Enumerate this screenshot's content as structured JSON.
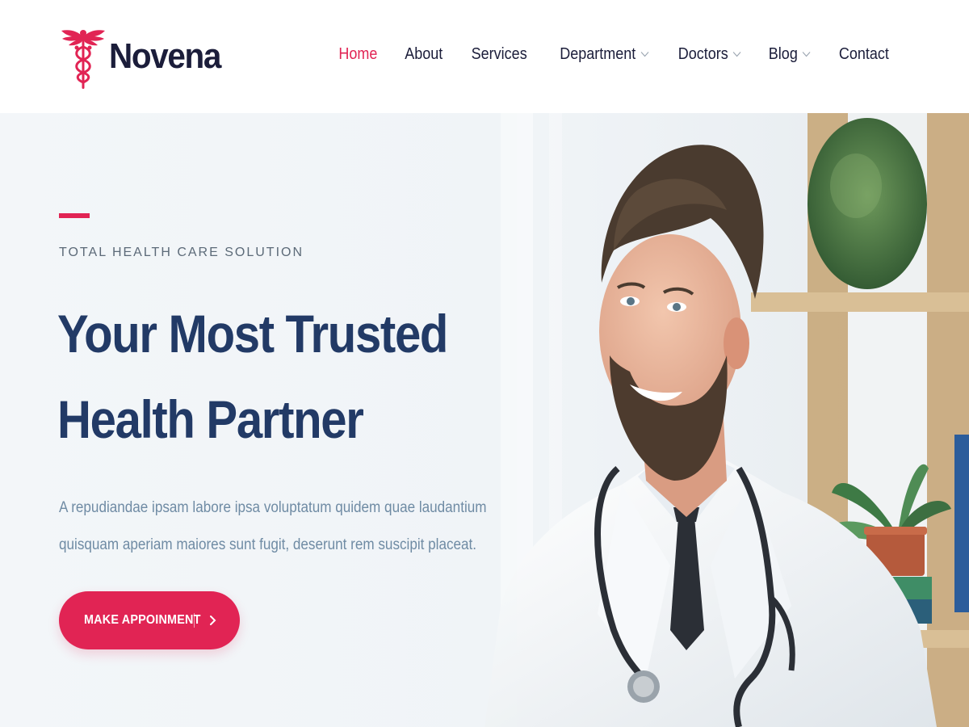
{
  "brand": {
    "name": "Novena",
    "logo_icon": "caduceus-icon",
    "accent_color": "#e12454",
    "heading_color": "#223a66"
  },
  "nav": {
    "items": [
      {
        "label": "Home",
        "active": true,
        "dropdown": false
      },
      {
        "label": "About",
        "active": false,
        "dropdown": false
      },
      {
        "label": "Services",
        "active": false,
        "dropdown": false
      },
      {
        "label": "Department",
        "active": false,
        "dropdown": true
      },
      {
        "label": "Doctors",
        "active": false,
        "dropdown": true
      },
      {
        "label": "Blog",
        "active": false,
        "dropdown": true
      },
      {
        "label": "Contact",
        "active": false,
        "dropdown": false
      }
    ]
  },
  "hero": {
    "eyebrow": "TOTAL HEALTH CARE SOLUTION",
    "title_line1": "Your Most Trusted",
    "title_line2": "Health Partner",
    "description": "A repudiandae ipsam labore ipsa voluptatum quidem quae laudantium quisquam aperiam maiores sunt fugit, deserunt rem suscipit placeat.",
    "cta_label": "MAKE APPOINMENT",
    "cta_icon": "chevron-right-icon"
  }
}
